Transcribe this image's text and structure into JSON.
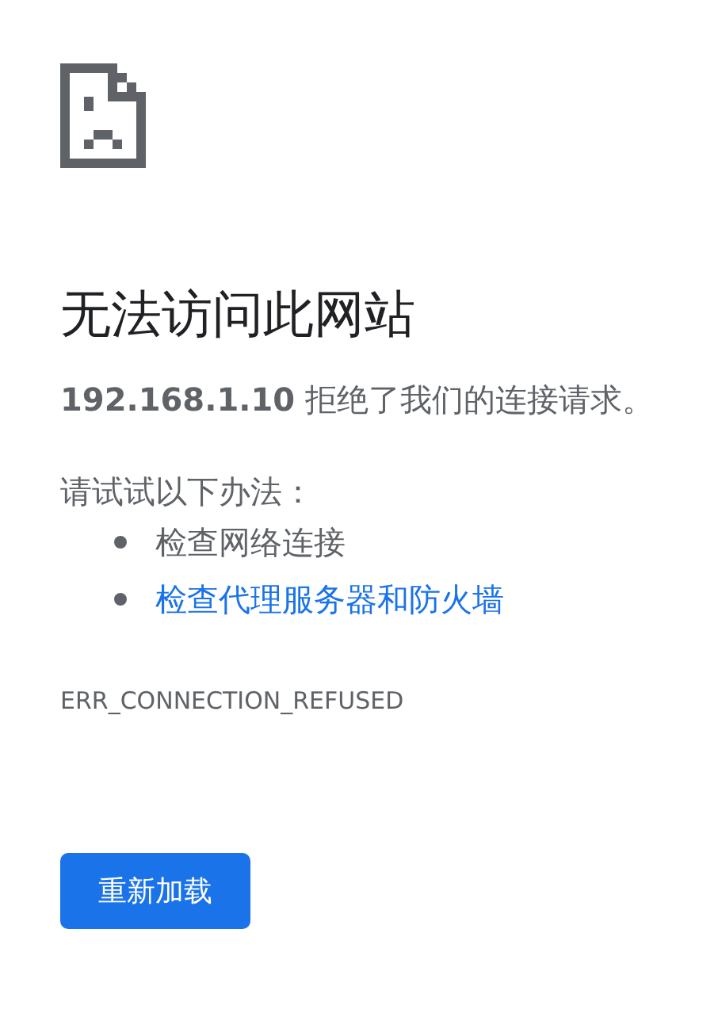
{
  "title": "无法访问此网站",
  "description": "**192.168.1.10** 拒绝了我们的连接请求。",
  "suggestions_heading": "请试试以下办法：",
  "suggestions": [
    {
      "kind": "text",
      "label": "检查网络连接"
    },
    {
      "kind": "link",
      "label": "检查代理服务器和防火墙"
    }
  ],
  "error_code": "ERR_CONNECTION_REFUSED",
  "button": "重新加载"
}
